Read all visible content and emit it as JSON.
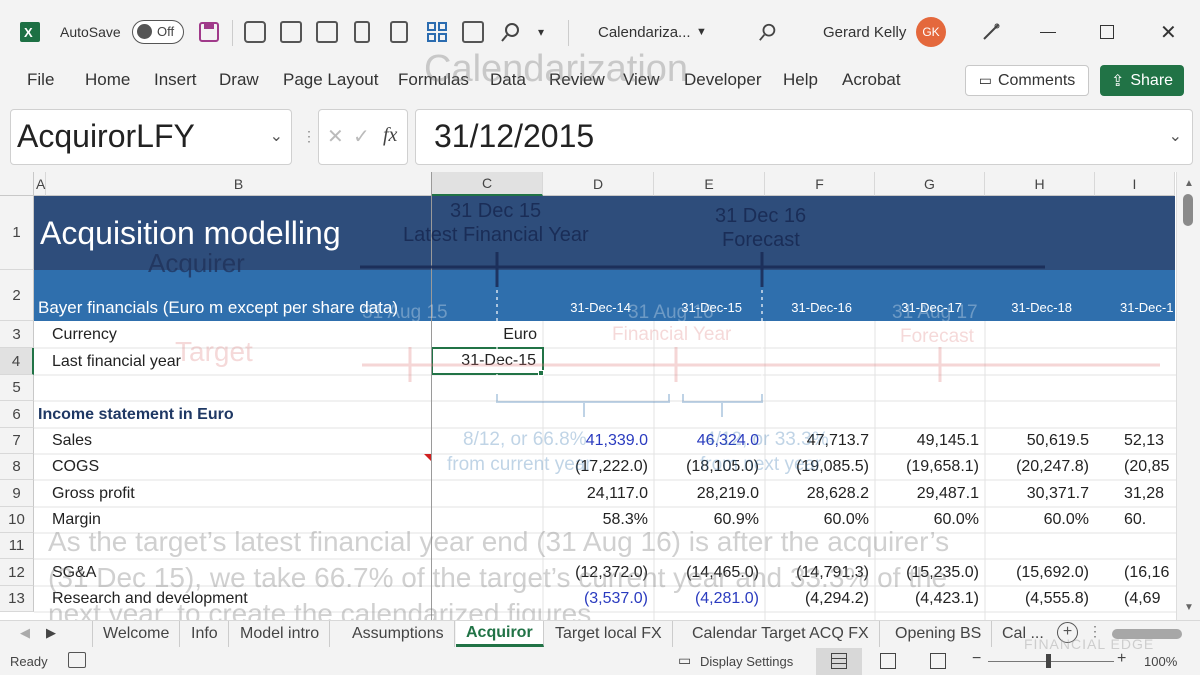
{
  "titlebar": {
    "autosave_label": "AutoSave",
    "autosave_state": "Off",
    "filename": "Calendariza...",
    "user_name": "Gerard Kelly",
    "user_initials": "GK"
  },
  "menu": {
    "items": [
      "File",
      "Home",
      "Insert",
      "Draw",
      "Page Layout",
      "Formulas",
      "Data",
      "Review",
      "View",
      "Developer",
      "Help",
      "Acrobat"
    ],
    "comments_label": "Comments",
    "share_label": "Share"
  },
  "formula_bar": {
    "name_box": "AcquirorLFY",
    "fx": "fx",
    "value": "31/12/2015"
  },
  "columns": [
    "A",
    "B",
    "C",
    "D",
    "E",
    "F",
    "G",
    "H",
    "I"
  ],
  "rows": [
    "1",
    "2",
    "3",
    "4",
    "5",
    "6",
    "7",
    "8",
    "9",
    "10",
    "11",
    "12",
    "13"
  ],
  "sheet": {
    "title": "Acquisition modelling",
    "subtitle": "Bayer financials (Euro m except per share data)",
    "dates": [
      "31-Dec-14",
      "31-Dec-15",
      "31-Dec-16",
      "31-Dec-17",
      "31-Dec-18",
      "31-Dec-1"
    ],
    "currency_label": "Currency",
    "currency_value": "Euro",
    "lfy_label": "Last financial year",
    "lfy_value": "31-Dec-15",
    "income_header": "Income statement in Euro",
    "lines": [
      {
        "label": "Sales",
        "values": [
          "41,339.0",
          "46,324.0",
          "47,713.7",
          "49,145.1",
          "50,619.5",
          "52,13"
        ]
      },
      {
        "label": "COGS",
        "values": [
          "(17,222.0)",
          "(18,105.0)",
          "(19,085.5)",
          "(19,658.1)",
          "(20,247.8)",
          "(20,85"
        ]
      },
      {
        "label": "Gross profit",
        "values": [
          "24,117.0",
          "28,219.0",
          "28,628.2",
          "29,487.1",
          "30,371.7",
          "31,28"
        ]
      },
      {
        "label": "Margin",
        "values": [
          "58.3%",
          "60.9%",
          "60.0%",
          "60.0%",
          "60.0%",
          "60."
        ]
      },
      {
        "label": "",
        "values": [
          "",
          "",
          "",
          "",
          "",
          ""
        ]
      },
      {
        "label": "SG&A",
        "values": [
          "(12,372.0)",
          "(14,465.0)",
          "(14,791.3)",
          "(15,235.0)",
          "(15,692.0)",
          "(16,16"
        ]
      },
      {
        "label": "Research and development",
        "values": [
          "(3,537.0)",
          "(4,281.0)",
          "(4,294.2)",
          "(4,423.1)",
          "(4,555.8)",
          "(4,69"
        ]
      }
    ]
  },
  "overlay": {
    "calendarization": "Calendarization",
    "acquirer": "Acquirer",
    "target": "Target",
    "d1": "31 Dec 15",
    "d1b": "Latest Financial Year",
    "d2": "31 Dec 16",
    "d2b": "Forecast",
    "aug15": "31 Aug 15",
    "aug16": "31 Aug 16",
    "aug17": "31 Aug 17",
    "tfy": "Financial Year",
    "tfc": "Forecast",
    "frac1": "8/12, or 66.8%",
    "frac1b": "from current year",
    "frac2": "4/12, or 33.3%",
    "frac2b": "from next year",
    "note1": "As the target’s latest financial year end (31 Aug 16) is after the acquirer’s",
    "note2": "(31 Dec 15), we take 66.7% of the target’s current year and 33.3% of the",
    "note3": "next year, to create the calendarized figures",
    "brand": "FINANCIAL EDGE"
  },
  "tabs": [
    "Welcome",
    "Info",
    "Model intro",
    "Assumptions",
    "Acquiror",
    "Target local FX",
    "Calendar Target ACQ FX",
    "Opening BS",
    "Cal ..."
  ],
  "status": {
    "ready": "Ready",
    "display_settings": "Display Settings",
    "zoom": "100%"
  },
  "colors": {
    "accent": "#217346",
    "title_band": "#2e4d7b",
    "subtitle_band": "#2f6fad",
    "section_text": "#1f3864",
    "input_blue": "#2a3bbf"
  }
}
